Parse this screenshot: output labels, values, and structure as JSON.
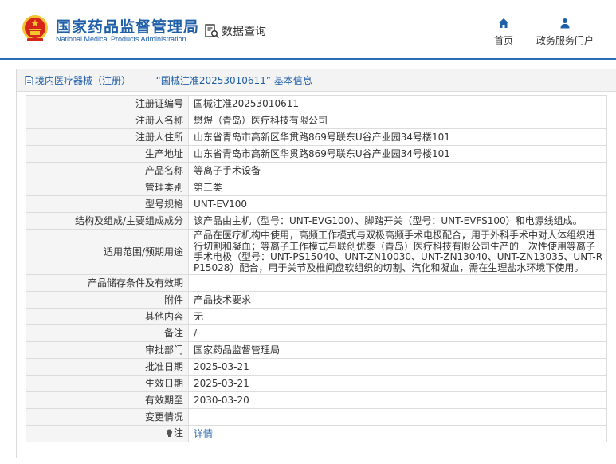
{
  "header": {
    "brand_cn": "国家药品监督管理局",
    "brand_en": "National Medical Products Administration",
    "query_label": "数据查询",
    "nav": {
      "home": "首页",
      "portal": "政务服务门户"
    },
    "colors": {
      "brand": "#1f5fa8",
      "emblem_red": "#d6261c",
      "emblem_gold": "#f4c430"
    }
  },
  "panel": {
    "title": "境内医疗器械（注册） —— “国械注准20253010611” 基本信息"
  },
  "rows": [
    {
      "label": "注册证编号",
      "value": "国械注准20253010611"
    },
    {
      "label": "注册人名称",
      "value": "懋煜（青岛）医疗科技有限公司"
    },
    {
      "label": "注册人住所",
      "value": "山东省青岛市高新区华贯路869号联东U谷产业园34号楼101"
    },
    {
      "label": "生产地址",
      "value": "山东省青岛市高新区华贯路869号联东U谷产业园34号楼101"
    },
    {
      "label": "产品名称",
      "value": "等离子手术设备"
    },
    {
      "label": "管理类别",
      "value": "第三类"
    },
    {
      "label": "型号规格",
      "value": "UNT-EV100"
    },
    {
      "label": "结构及组成/主要组成成分",
      "value": "该产品由主机（型号：UNT-EVG100）、脚踏开关（型号：UNT-EVFS100）和电源线组成。"
    },
    {
      "label": "适用范围/预期用途",
      "value": "产品在医疗机构中使用，高频工作模式与双极高频手术电极配合，用于外科手术中对人体组织进行切割和凝血；等离子工作模式与联创优泰（青岛）医疗科技有限公司生产的一次性使用等离子手术电极（型号：UNT-PS15040、UNT-ZN10030、UNT-ZN13040、UNT-ZN13035、UNT-RP15028）配合，用于关节及椎间盘软组织的切割、汽化和凝血，需在生理盐水环境下使用。"
    },
    {
      "label": "产品储存条件及有效期",
      "value": ""
    },
    {
      "label": "附件",
      "value": "产品技术要求"
    },
    {
      "label": "其他内容",
      "value": "无"
    },
    {
      "label": "备注",
      "value": "/"
    },
    {
      "label": "审批部门",
      "value": "国家药品监督管理局"
    },
    {
      "label": "批准日期",
      "value": "2025-03-21"
    },
    {
      "label": "生效日期",
      "value": "2025-03-21"
    },
    {
      "label": "有效期至",
      "value": "2030-03-20"
    },
    {
      "label": "变更情况",
      "value": ""
    },
    {
      "label": "注",
      "value": "详情"
    }
  ]
}
